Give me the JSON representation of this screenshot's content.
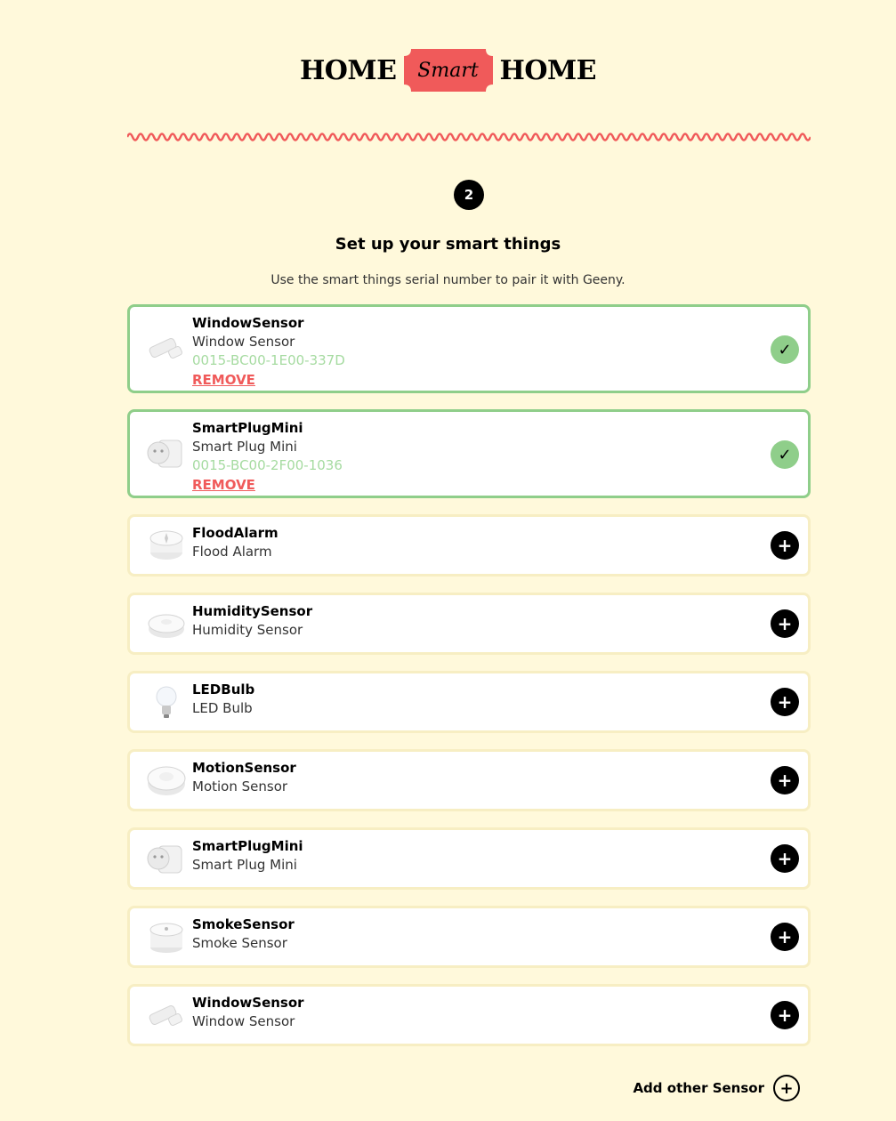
{
  "logo": {
    "left": "HOME",
    "badge": "Smart",
    "right": "HOME",
    "badge_color": "#f05a5a"
  },
  "step": {
    "number": "2"
  },
  "header": {
    "title": "Set up your smart things",
    "subtitle": "Use the smart things serial number to pair it with Geeny."
  },
  "paired": [
    {
      "name": "WindowSensor",
      "desc": "Window Sensor",
      "serial": "0015-BC00-1E00-337D",
      "remove": "REMOVE",
      "icon": "window-sensor-icon"
    },
    {
      "name": "SmartPlugMini",
      "desc": "Smart Plug Mini",
      "serial": "0015-BC00-2F00-1036",
      "remove": "REMOVE",
      "icon": "smart-plug-icon"
    }
  ],
  "available": [
    {
      "name": "FloodAlarm",
      "desc": "Flood Alarm",
      "icon": "flood-alarm-icon"
    },
    {
      "name": "HumiditySensor",
      "desc": "Humidity Sensor",
      "icon": "humidity-sensor-icon"
    },
    {
      "name": "LEDBulb",
      "desc": "LED Bulb",
      "icon": "led-bulb-icon"
    },
    {
      "name": "MotionSensor",
      "desc": "Motion Sensor",
      "icon": "motion-sensor-icon"
    },
    {
      "name": "SmartPlugMini",
      "desc": "Smart Plug Mini",
      "icon": "smart-plug-icon"
    },
    {
      "name": "SmokeSensor",
      "desc": "Smoke Sensor",
      "icon": "smoke-sensor-icon"
    },
    {
      "name": "WindowSensor",
      "desc": "Window Sensor",
      "icon": "window-sensor-icon"
    }
  ],
  "add_other": {
    "label": "Add other Sensor"
  },
  "colors": {
    "background": "#fff9db",
    "paired_border": "#8fce8a",
    "accent": "#f05a5a"
  }
}
